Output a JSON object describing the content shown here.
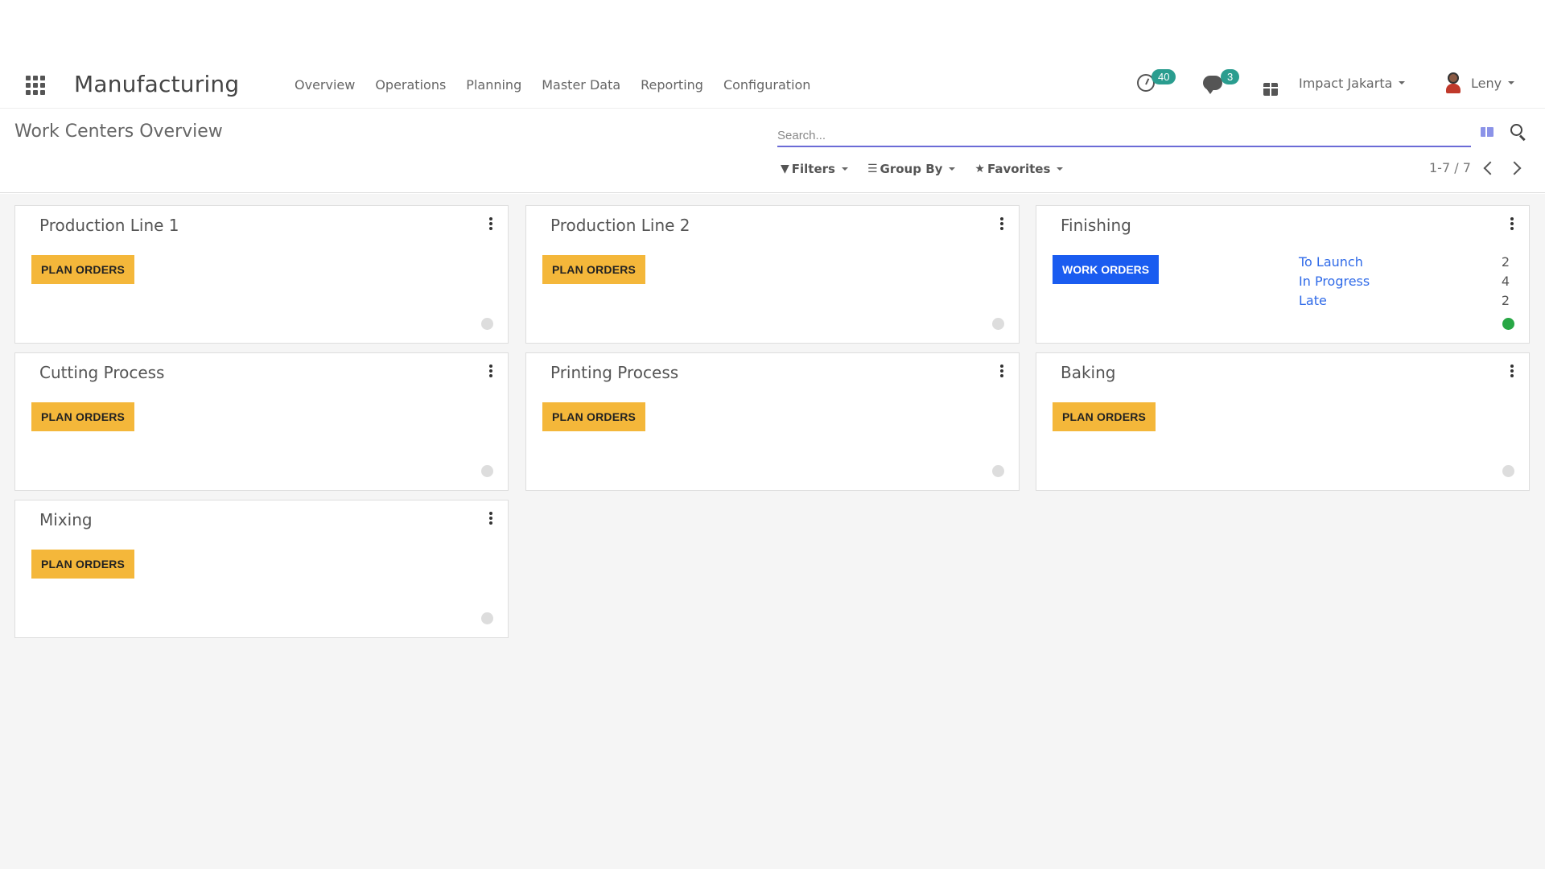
{
  "app": {
    "title": "Manufacturing"
  },
  "menu": [
    "Overview",
    "Operations",
    "Planning",
    "Master Data",
    "Reporting",
    "Configuration"
  ],
  "systray": {
    "activities_count": "40",
    "messages_count": "3",
    "company": "Impact Jakarta",
    "user": "Leny",
    "badge_color": "#2a9d8f"
  },
  "breadcrumb": "Work Centers Overview",
  "search": {
    "placeholder": "Search..."
  },
  "filters": {
    "filters_label": "Filters",
    "groupby_label": "Group By",
    "favorites_label": "Favorites"
  },
  "pager": {
    "value": "1-7 / 7"
  },
  "cards": [
    {
      "name": "Production Line 1",
      "button": "PLAN ORDERS",
      "status": "grey"
    },
    {
      "name": "Production Line 2",
      "button": "PLAN ORDERS",
      "status": "grey"
    },
    {
      "name": "Finishing",
      "button": "WORK ORDERS",
      "status": "green",
      "stats": [
        {
          "label": "To Launch",
          "value": "2"
        },
        {
          "label": "In Progress",
          "value": "4"
        },
        {
          "label": "Late",
          "value": "2"
        }
      ]
    },
    {
      "name": "Cutting Process",
      "button": "PLAN ORDERS",
      "status": "grey"
    },
    {
      "name": "Printing Process",
      "button": "PLAN ORDERS",
      "status": "grey"
    },
    {
      "name": "Baking",
      "button": "PLAN ORDERS",
      "status": "grey"
    },
    {
      "name": "Mixing",
      "button": "PLAN ORDERS",
      "status": "grey"
    }
  ],
  "colors": {
    "plan_button": "#f4b73a",
    "work_button": "#1a5cf0",
    "link": "#2f6ae8",
    "status_green": "#28a745",
    "search_underline": "#6b6bd6"
  }
}
